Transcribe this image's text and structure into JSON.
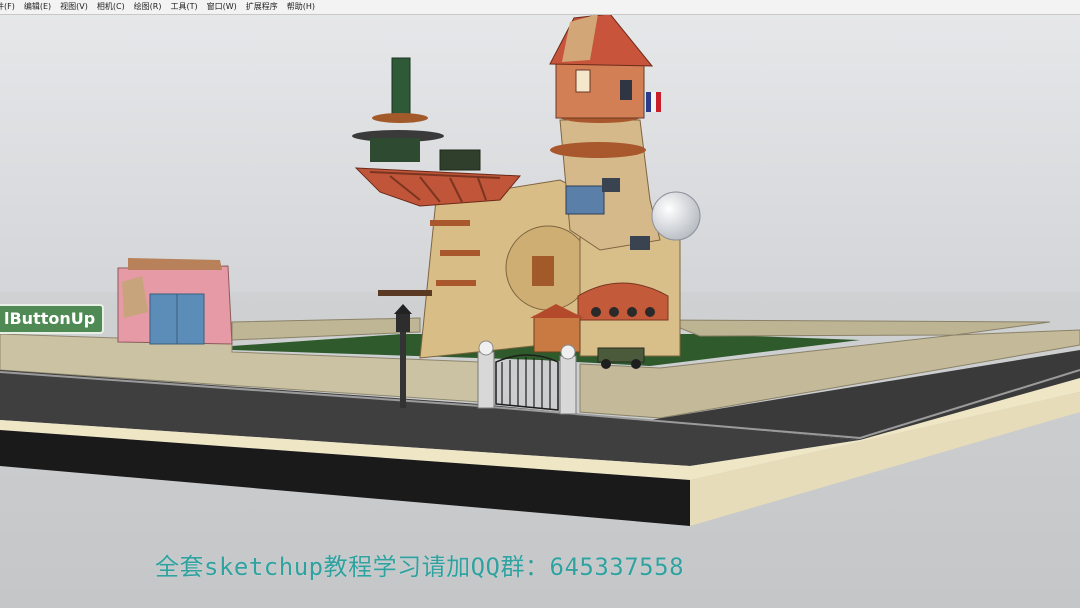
{
  "app": {
    "menu": [
      {
        "label": "件(F)"
      },
      {
        "label": "编辑(E)"
      },
      {
        "label": "视图(V)"
      },
      {
        "label": "相机(C)"
      },
      {
        "label": "绘图(R)"
      },
      {
        "label": "工具(T)"
      },
      {
        "label": "窗口(W)"
      },
      {
        "label": "扩展程序"
      },
      {
        "label": "帮助(H)"
      }
    ]
  },
  "viewport": {
    "overlay_label": "lButtonUp",
    "caption": "全套sketchup教程学习请加QQ群：645337558"
  },
  "colors": {
    "sky": "#d9dbde",
    "ground": "#c9cbcd",
    "grass": "#2f5a2c",
    "wall": "#cfc6a8",
    "road": "#3d3d3d",
    "caption": "#2fa2a0",
    "badge": "#4f8a55"
  }
}
